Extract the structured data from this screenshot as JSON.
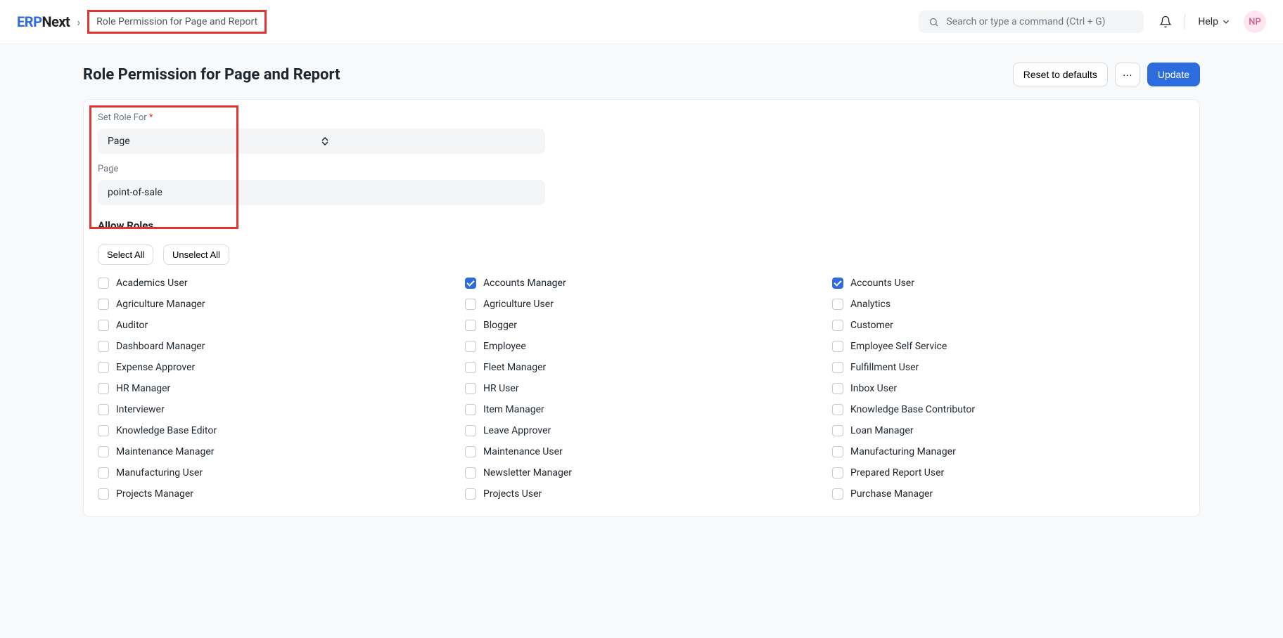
{
  "header": {
    "logo_bold": "ERP",
    "logo_rest": "Next",
    "breadcrumb": "Role Permission for Page and Report",
    "search_placeholder": "Search or type a command (Ctrl + G)",
    "help_label": "Help",
    "avatar_initials": "NP"
  },
  "page": {
    "title": "Role Permission for Page and Report",
    "reset_label": "Reset to defaults",
    "update_label": "Update"
  },
  "form": {
    "set_role_for_label": "Set Role For",
    "set_role_for_value": "Page",
    "page_label": "Page",
    "page_value": "point-of-sale"
  },
  "roles_section": {
    "title": "Allow Roles",
    "select_all": "Select All",
    "unselect_all": "Unselect All",
    "roles": [
      {
        "label": "Academics User",
        "checked": false
      },
      {
        "label": "Accounts Manager",
        "checked": true
      },
      {
        "label": "Accounts User",
        "checked": true
      },
      {
        "label": "Agriculture Manager",
        "checked": false
      },
      {
        "label": "Agriculture User",
        "checked": false
      },
      {
        "label": "Analytics",
        "checked": false
      },
      {
        "label": "Auditor",
        "checked": false
      },
      {
        "label": "Blogger",
        "checked": false
      },
      {
        "label": "Customer",
        "checked": false
      },
      {
        "label": "Dashboard Manager",
        "checked": false
      },
      {
        "label": "Employee",
        "checked": false
      },
      {
        "label": "Employee Self Service",
        "checked": false
      },
      {
        "label": "Expense Approver",
        "checked": false
      },
      {
        "label": "Fleet Manager",
        "checked": false
      },
      {
        "label": "Fulfillment User",
        "checked": false
      },
      {
        "label": "HR Manager",
        "checked": false
      },
      {
        "label": "HR User",
        "checked": false
      },
      {
        "label": "Inbox User",
        "checked": false
      },
      {
        "label": "Interviewer",
        "checked": false
      },
      {
        "label": "Item Manager",
        "checked": false
      },
      {
        "label": "Knowledge Base Contributor",
        "checked": false
      },
      {
        "label": "Knowledge Base Editor",
        "checked": false
      },
      {
        "label": "Leave Approver",
        "checked": false
      },
      {
        "label": "Loan Manager",
        "checked": false
      },
      {
        "label": "Maintenance Manager",
        "checked": false
      },
      {
        "label": "Maintenance User",
        "checked": false
      },
      {
        "label": "Manufacturing Manager",
        "checked": false
      },
      {
        "label": "Manufacturing User",
        "checked": false
      },
      {
        "label": "Newsletter Manager",
        "checked": false
      },
      {
        "label": "Prepared Report User",
        "checked": false
      },
      {
        "label": "Projects Manager",
        "checked": false
      },
      {
        "label": "Projects User",
        "checked": false
      },
      {
        "label": "Purchase Manager",
        "checked": false
      }
    ]
  }
}
